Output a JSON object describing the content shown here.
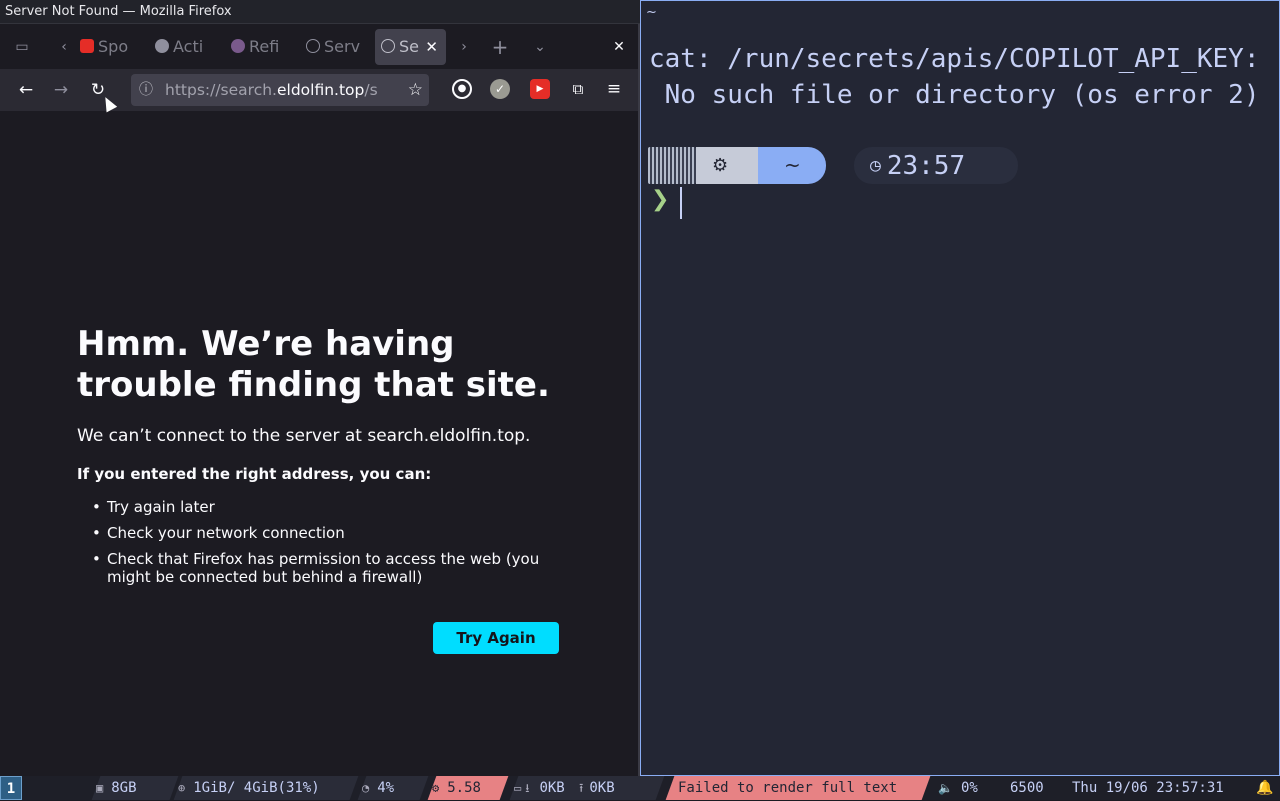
{
  "firefox": {
    "window_title": "Server Not Found — Mozilla Firefox",
    "tabs": [
      {
        "label": "Spo",
        "icon": "youtube-icon"
      },
      {
        "label": "Acti",
        "icon": "actions-icon"
      },
      {
        "label": "Refi",
        "icon": "github-icon"
      },
      {
        "label": "Serv",
        "icon": "info-icon"
      },
      {
        "label": "Se",
        "icon": "info-icon",
        "active": true
      }
    ],
    "url": {
      "prefix": "https://search.",
      "host": "eldolfin.top",
      "suffix": "/s"
    },
    "error": {
      "title": "Hmm. We’re having trouble finding that site.",
      "description": "We can’t connect to the server at search.eldolfin.top.",
      "subtitle": "If you entered the right address, you can:",
      "suggestions": [
        "Try again later",
        "Check your network connection",
        "Check that Firefox has permission to access the web (you might be connected but behind a firewall)"
      ],
      "button": "Try Again"
    }
  },
  "terminal": {
    "title": "~",
    "error_line1": "cat: /run/secrets/apis/COPILOT_API_KEY:",
    "error_line2": " No such file or directory (os error 2)",
    "prompt_dir": "~",
    "prompt_time": "23:57",
    "prompt_char": "❯"
  },
  "statusbar": {
    "workspace": "1",
    "disk": "8GB",
    "memory": "1GiB/ 4GiB(31%)",
    "cpu": "4%",
    "load": "5.58",
    "net_down": "0KB",
    "net_up": "0KB",
    "message": "Failed to render full text",
    "volume": "0%",
    "temperature": "6500",
    "datetime": "Thu 19/06 23:57:31"
  },
  "colors": {
    "accent": "#00ddff",
    "terminal_bg": "#232634",
    "prompt_blue": "#8aadf4",
    "alert_red": "#e78284"
  }
}
